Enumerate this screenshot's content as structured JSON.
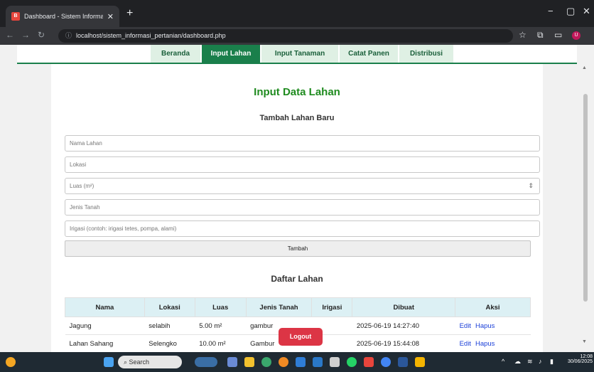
{
  "browser": {
    "tab_title": "Dashboard - Sistem Informasi",
    "url": "localhost/sistem_informasi_pertanian/dashboard.php"
  },
  "nav": [
    "Beranda",
    "Input Lahan",
    "Input Tanaman",
    "Catat Panen",
    "Distribusi"
  ],
  "nav_active": "Input Lahan",
  "page": {
    "title": "Input Data Lahan",
    "form_title": "Tambah Lahan Baru",
    "placeholders": {
      "nama": "Nama Lahan",
      "lokasi": "Lokasi",
      "luas": "Luas (m²)",
      "jenis": "Jenis Tanah",
      "irigasi": "Irigasi (contoh: irigasi tetes, pompa, alami)"
    },
    "submit_label": "Tambah",
    "list_title": "Daftar Lahan",
    "logout_label": "Logout"
  },
  "table": {
    "headers": [
      "Nama",
      "Lokasi",
      "Luas",
      "Jenis Tanah",
      "Irigasi",
      "Dibuat",
      "Aksi"
    ],
    "rows": [
      {
        "nama": "Jagung",
        "lokasi": "selabih",
        "luas": "5.00 m²",
        "jenis": "gambur",
        "irigasi": "",
        "dibuat": "2025-06-19 14:27:40",
        "edit": "Edit",
        "hapus": "Hapus"
      },
      {
        "nama": "Lahan Sahang",
        "lokasi": "Selengko",
        "luas": "10.00 m²",
        "jenis": "Gambur",
        "irigasi": "",
        "dibuat": "2025-06-19 15:44:08",
        "edit": "Edit",
        "hapus": "Hapus"
      }
    ]
  },
  "taskbar": {
    "search": "Search",
    "time": "12:08",
    "date": "30/06/2025"
  },
  "colors": {
    "accent": "#1a7f4b",
    "title_green": "#1f8b1f",
    "logout": "#dc3545",
    "link": "#1a3fd8"
  }
}
